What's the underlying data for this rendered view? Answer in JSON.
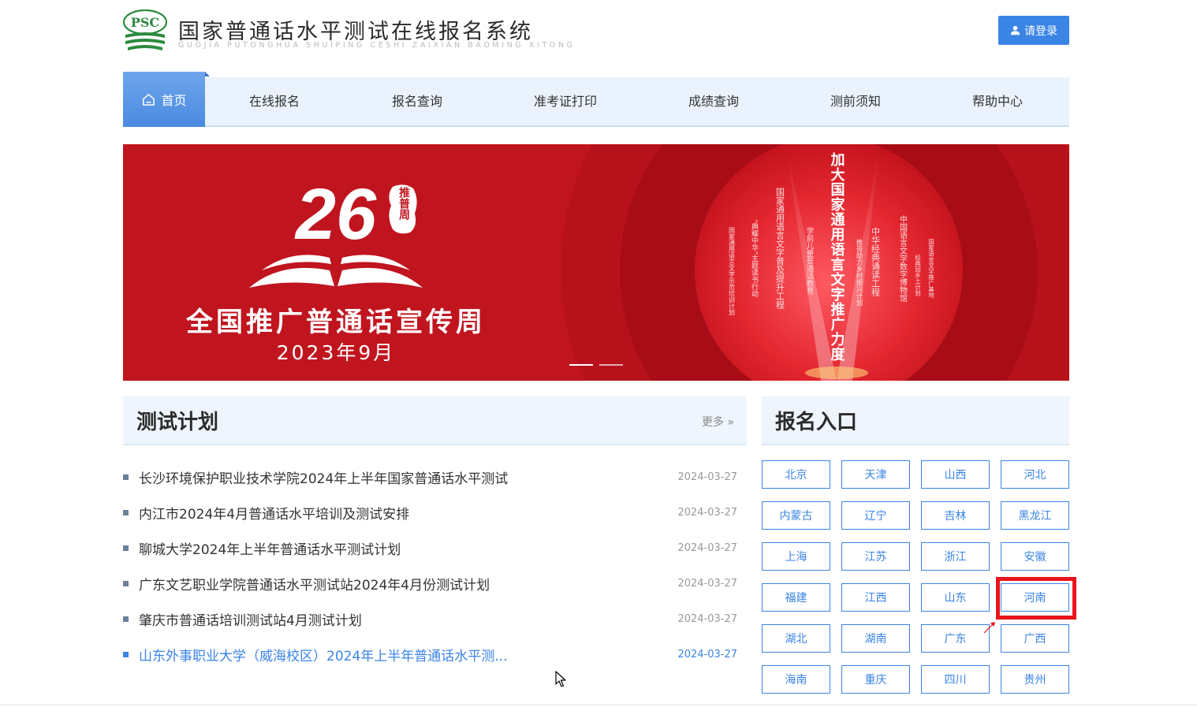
{
  "header": {
    "logo_text": "PSC",
    "title": "国家普通话水平测试在线报名系统",
    "subtitle": "GUOJIA PUTONGHUA SHUIPING CESHI ZAIXIAN BAOMING XITONG",
    "login_label": "请登录"
  },
  "nav": {
    "home": "首页",
    "items": [
      "在线报名",
      "报名查询",
      "准考证打印",
      "成绩查询",
      "测前须知",
      "帮助中心"
    ]
  },
  "banner": {
    "number": "26",
    "seal": "推普周",
    "headline": "全国推广普通话宣传周",
    "date": "2023年9月",
    "center_slogan": "加大国家通用语言文字推广力度",
    "vertical_texts": [
      "国家通用语言文字示范培训计划",
      "“典耀中华”主题读书行动",
      "国家通用语言文字普及提升工程",
      "学前儿童普通话教育",
      "中华经典诵读工程",
      "推普助力乡村振兴计划",
      "中国语言文字数字博物馆",
      "经典润乡土计划",
      "国家语言文字推广基地"
    ],
    "slides": 2,
    "active_slide": 1
  },
  "test_plan": {
    "title": "测试计划",
    "more_label": "更多",
    "items": [
      {
        "title": "长沙环境保护职业技术学院2024年上半年国家普通话水平测试",
        "date": "2024-03-27"
      },
      {
        "title": "内江市2024年4月普通话水平培训及测试安排",
        "date": "2024-03-27"
      },
      {
        "title": "聊城大学2024年上半年普通话水平测试计划",
        "date": "2024-03-27"
      },
      {
        "title": "广东文艺职业学院普通话水平测试站2024年4月份测试计划",
        "date": "2024-03-27"
      },
      {
        "title": "肇庆市普通话培训测试站4月测试计划",
        "date": "2024-03-27"
      },
      {
        "title": "山东外事职业大学（威海校区）2024年上半年普通话水平测...",
        "date": "2024-03-27"
      }
    ]
  },
  "registration": {
    "title": "报名入口",
    "provinces": [
      "北京",
      "天津",
      "山西",
      "河北",
      "内蒙古",
      "辽宁",
      "吉林",
      "黑龙江",
      "上海",
      "江苏",
      "浙江",
      "安徽",
      "福建",
      "江西",
      "山东",
      "河南",
      "湖北",
      "湖南",
      "广东",
      "广西",
      "海南",
      "重庆",
      "四川",
      "贵州"
    ],
    "highlighted": "河南"
  },
  "colors": {
    "primary": "#3a84e6",
    "nav_bg": "#eaf3fd",
    "banner_red": "#c0151f",
    "highlight_red": "#e8141c"
  }
}
